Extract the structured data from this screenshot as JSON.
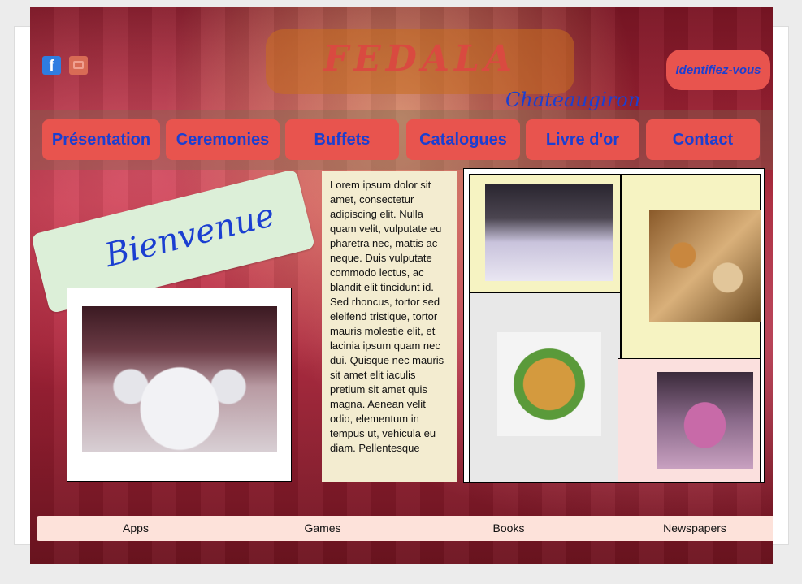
{
  "brand": {
    "title": "FEDALA",
    "subtitle": "Chateaugiron"
  },
  "header": {
    "social": [
      {
        "icon": "facebook-icon"
      },
      {
        "icon": "youtube-icon"
      }
    ],
    "login_label": "Identifiez-vous"
  },
  "nav": {
    "items": [
      {
        "label": "Présentation"
      },
      {
        "label": "Ceremonies"
      },
      {
        "label": "Buffets"
      },
      {
        "label": "Catalogues"
      },
      {
        "label": "Livre d'or"
      },
      {
        "label": "Contact"
      }
    ]
  },
  "welcome": {
    "text": "Bienvenue"
  },
  "content": {
    "lorem": "Lorem ipsum dolor sit amet, consectetur adipiscing elit. Nulla quam velit, vulputate eu pharetra nec, mattis ac neque. Duis vulputate commodo lectus, ac blandit elit tincidunt id. Sed rhoncus, tortor sed eleifend tristique, tortor mauris molestie elit, et lacinia ipsum quam nec dui. Quisque nec mauris sit amet elit iaculis pretium sit amet quis magna. Aenean velit odio, elementum in tempus ut, vehicula eu diam. Pellentesque"
  },
  "gallery": {
    "tile_colors": [
      "#f6f3c2",
      "#f6f3c2",
      "#e8e8e8",
      "#fbe0de"
    ]
  },
  "footer": {
    "links": [
      {
        "label": "Apps"
      },
      {
        "label": "Games"
      },
      {
        "label": "Books"
      },
      {
        "label": "Newspapers"
      }
    ]
  },
  "colors": {
    "accent": "#e8544e",
    "link_blue": "#1b3fd1",
    "footer_bg": "#fde2da"
  }
}
